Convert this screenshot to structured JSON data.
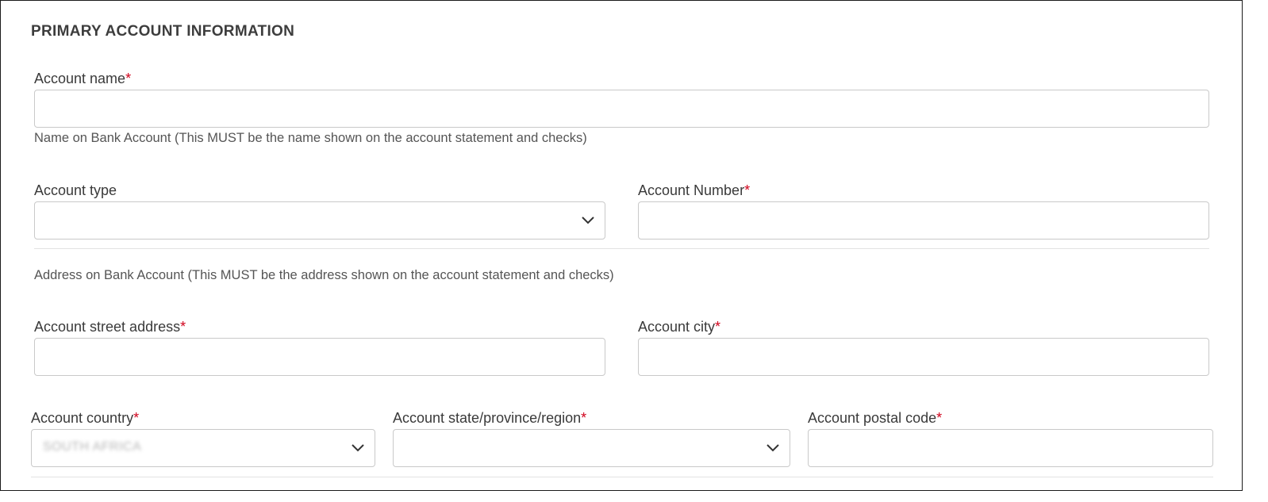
{
  "section": {
    "title": "PRIMARY ACCOUNT INFORMATION"
  },
  "fields": {
    "account_name": {
      "label": "Account name",
      "required": "*",
      "value": "",
      "hint": "Name on Bank Account (This MUST be the name shown on the account statement and checks)"
    },
    "account_type": {
      "label": "Account type",
      "selected": ""
    },
    "account_number": {
      "label": "Account Number",
      "required": "*",
      "value": ""
    },
    "address_note": "Address on Bank Account (This MUST be the address shown on the account statement and checks)",
    "street": {
      "label": "Account street address",
      "required": "*",
      "value": ""
    },
    "city": {
      "label": "Account city",
      "required": "*",
      "value": ""
    },
    "country": {
      "label": "Account country",
      "required": "*",
      "selected": "SOUTH AFRICA"
    },
    "state": {
      "label": "Account state/province/region",
      "required": "*",
      "selected": ""
    },
    "postal": {
      "label": "Account postal code",
      "required": "*",
      "value": ""
    }
  },
  "icons": {
    "dropdown": "chevron-down-icon"
  },
  "colors": {
    "required": "#d0021b",
    "border": "#c9c9c9",
    "frame": "#1a1a1a"
  }
}
